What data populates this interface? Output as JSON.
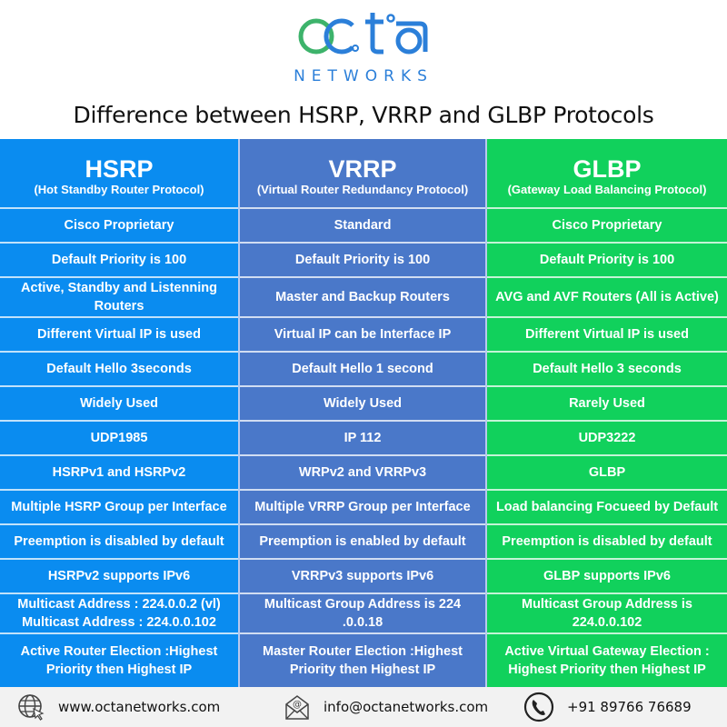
{
  "brand": {
    "logo_text": "octa",
    "logo_subtext": "NETWORKS",
    "colors": {
      "blue": "#2b7fd9",
      "green": "#3db36b"
    }
  },
  "title": "Difference between HSRP, VRRP and GLBP Protocols",
  "columns": [
    {
      "name": "HSRP",
      "full_name": "(Hot Standby Router Protocol)",
      "color": "#0a8cf0",
      "rows": [
        "Cisco Proprietary",
        "Default Priority is 100",
        "Active, Standby and Listenning Routers",
        "Different Virtual IP is used",
        "Default Hello 3seconds",
        "Widely Used",
        "UDP1985",
        "HSRPv1 and HSRPv2",
        "Multiple HSRP Group per Interface",
        "Preemption is disabled by default",
        "HSRPv2 supports IPv6",
        "Multicast Address : 224.0.0.2 (vl) Multicast Address : 224.0.0.102",
        "Active Router Election :Highest Priority then Highest IP"
      ]
    },
    {
      "name": "VRRP",
      "full_name": "(Virtual Router Redundancy Protocol)",
      "color": "#4a78c9",
      "rows": [
        "Standard",
        "Default Priority is 100",
        "Master and Backup Routers",
        "Virtual IP can be Interface IP",
        "Default Hello 1 second",
        "Widely Used",
        "IP 112",
        "WRPv2 and VRRPv3",
        "Multiple VRRP Group per Interface",
        "Preemption is enabled by default",
        "VRRPv3 supports IPv6",
        "Multicast Group Address is 224 .0.0.18",
        "Master Router Election :Highest Priority then Highest IP"
      ]
    },
    {
      "name": "GLBP",
      "full_name": "(Gateway Load Balancing Protocol)",
      "color": "#11d15c",
      "rows": [
        "Cisco Proprietary",
        "Default Priority is 100",
        "AVG and AVF Routers (All is Active)",
        "Different Virtual IP is used",
        "Default Hello 3 seconds",
        "Rarely Used",
        "UDP3222",
        "GLBP",
        "Load balancing Focueed by Default",
        "Preemption is disabled by default",
        "GLBP supports IPv6",
        "Multicast Group Address is 224.0.0.102",
        "Active Virtual Gateway Election : Highest Priority then Highest IP"
      ]
    }
  ],
  "footer": {
    "website": {
      "icon": "globe-icon",
      "text": "www.octanetworks.com"
    },
    "email": {
      "icon": "envelope-icon",
      "text": "info@octanetworks.com"
    },
    "phone": {
      "icon": "phone-icon",
      "text": "+91 89766 76689"
    }
  }
}
